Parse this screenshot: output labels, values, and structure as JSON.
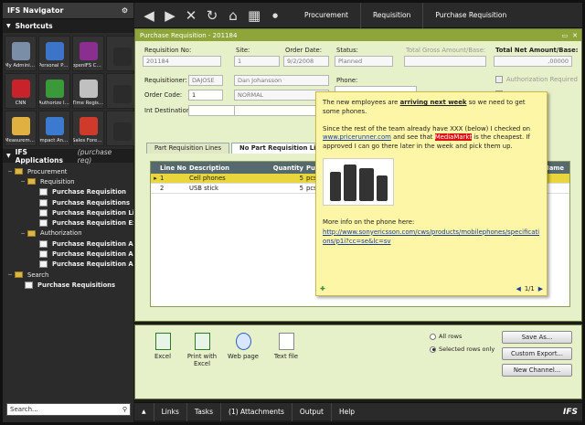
{
  "navigator": {
    "title": "IFS Navigator",
    "shortcuts_label": "Shortcuts",
    "shortcuts": [
      {
        "label": "My Administra...",
        "color": "#7a8ea8"
      },
      {
        "label": "Personal Portal",
        "color": "#3b74c8"
      },
      {
        "label": "openIFS Comm...",
        "color": "#8a2f8f"
      },
      {
        "label": "",
        "color": "#2b2b2b"
      },
      {
        "label": "CNN",
        "color": "#c8222a"
      },
      {
        "label": "Authorize Invo...",
        "color": "#3a9a3a"
      },
      {
        "label": "Time Registra...",
        "color": "#c0c0c0"
      },
      {
        "label": "",
        "color": "#2b2b2b"
      },
      {
        "label": "Measurements",
        "color": "#e0b040"
      },
      {
        "label": "Impact Analysis",
        "color": "#3c7ad0"
      },
      {
        "label": "Sales Forecast",
        "color": "#d03a2a"
      },
      {
        "label": "",
        "color": "#2b2b2b"
      }
    ],
    "apps_label": "IFS Applications",
    "apps_sub": "(purchase req)",
    "tree": [
      {
        "label": "Procurement",
        "type": "folder",
        "indent": 4,
        "bold": false,
        "plus": "−"
      },
      {
        "label": "Requisition",
        "type": "folder",
        "indent": 18,
        "bold": false,
        "plus": "−"
      },
      {
        "label": "Purchase Requisition",
        "type": "doc",
        "indent": 40,
        "bold": true,
        "plus": ""
      },
      {
        "label": "Purchase Requisitions",
        "type": "doc",
        "indent": 40,
        "bold": true,
        "plus": ""
      },
      {
        "label": "Purchase Requisition Line",
        "type": "doc",
        "indent": 40,
        "bold": true,
        "plus": ""
      },
      {
        "label": "Purchase Requisition Exce",
        "type": "doc",
        "indent": 40,
        "bold": true,
        "plus": ""
      },
      {
        "label": "Authorization",
        "type": "folder",
        "indent": 18,
        "bold": false,
        "plus": "−"
      },
      {
        "label": "Purchase Requisition Auth",
        "type": "doc",
        "indent": 40,
        "bold": true,
        "plus": ""
      },
      {
        "label": "Purchase Requisition Auth",
        "type": "doc",
        "indent": 40,
        "bold": true,
        "plus": ""
      },
      {
        "label": "Purchase Requisition Auth",
        "type": "doc",
        "indent": 40,
        "bold": true,
        "plus": ""
      },
      {
        "label": "Search",
        "type": "folder",
        "indent": 4,
        "bold": false,
        "plus": "−"
      },
      {
        "label": "Purchase Requisitions",
        "type": "doc",
        "indent": 24,
        "bold": true,
        "plus": ""
      }
    ],
    "search_placeholder": "Search..."
  },
  "topbar": {
    "crumbs": [
      "Procurement",
      "Requisition",
      "Purchase Requisition"
    ]
  },
  "form": {
    "title": "Purchase Requisition - 201184",
    "requisition_no_label": "Requisition No:",
    "requisition_no": "201184",
    "site_label": "Site:",
    "site": "1",
    "order_date_label": "Order Date:",
    "order_date": "9/2/2008",
    "status_label": "Status:",
    "status": "Planned",
    "gross_label": "Total Gross Amount/Base:",
    "net_label": "Total Net Amount/Base:",
    "net_value": ",00000",
    "requisitioner_label": "Requisitioner:",
    "requisitioner": "DAJOSE",
    "requisitioner_name": "Dan Johansson",
    "phone_label": "Phone:",
    "auth_required_label": "Authorization Required",
    "order_code_label": "Order Code:",
    "order_code": "1",
    "order_code_desc": "NORMAL",
    "int_dest_label": "Int Destination:",
    "tabs": [
      "Part Requisition Lines",
      "No Part Requisition Lines"
    ],
    "columns": [
      "Line No",
      "Description",
      "Quantity",
      "Pu"
    ],
    "more_column": "Name",
    "rows": [
      {
        "marker": "▸",
        "line": "1",
        "desc": "Cell phones",
        "qty": "5",
        "unit": "pcs"
      },
      {
        "marker": "",
        "line": "2",
        "desc": "USB stick",
        "qty": "5",
        "unit": "pcs"
      }
    ]
  },
  "note": {
    "p1_a": "The new employees are ",
    "p1_b": "arriving next week",
    "p1_c": " so we need to get some phones.",
    "p2_a": "Since the rest of the team already have XXX (below) I checked on ",
    "p2_link": "www.pricerunner.com",
    "p2_b": " and see that ",
    "p2_hl": "MediaMarkt",
    "p2_c": " is the cheapest. If approved I can go there later in the week and pick them up.",
    "p3": "More info on the phone here:",
    "p3_link": "http://www.sonyericsson.com/cws/products/mobilephones/specifications/p1i?cc=se&lc=sv",
    "page": "1/1"
  },
  "export": {
    "items": [
      "Excel",
      "Print with Excel",
      "Web page",
      "Text file"
    ],
    "radio_all": "All rows",
    "radio_selected": "Selected rows only",
    "save_as": "Save As...",
    "custom_export": "Custom Export...",
    "new_channel": "New Channel..."
  },
  "bottombar": {
    "arrow": "▲",
    "items": [
      "Links",
      "Tasks",
      "(1) Attachments",
      "Output",
      "Help"
    ],
    "logo": "IFS"
  }
}
